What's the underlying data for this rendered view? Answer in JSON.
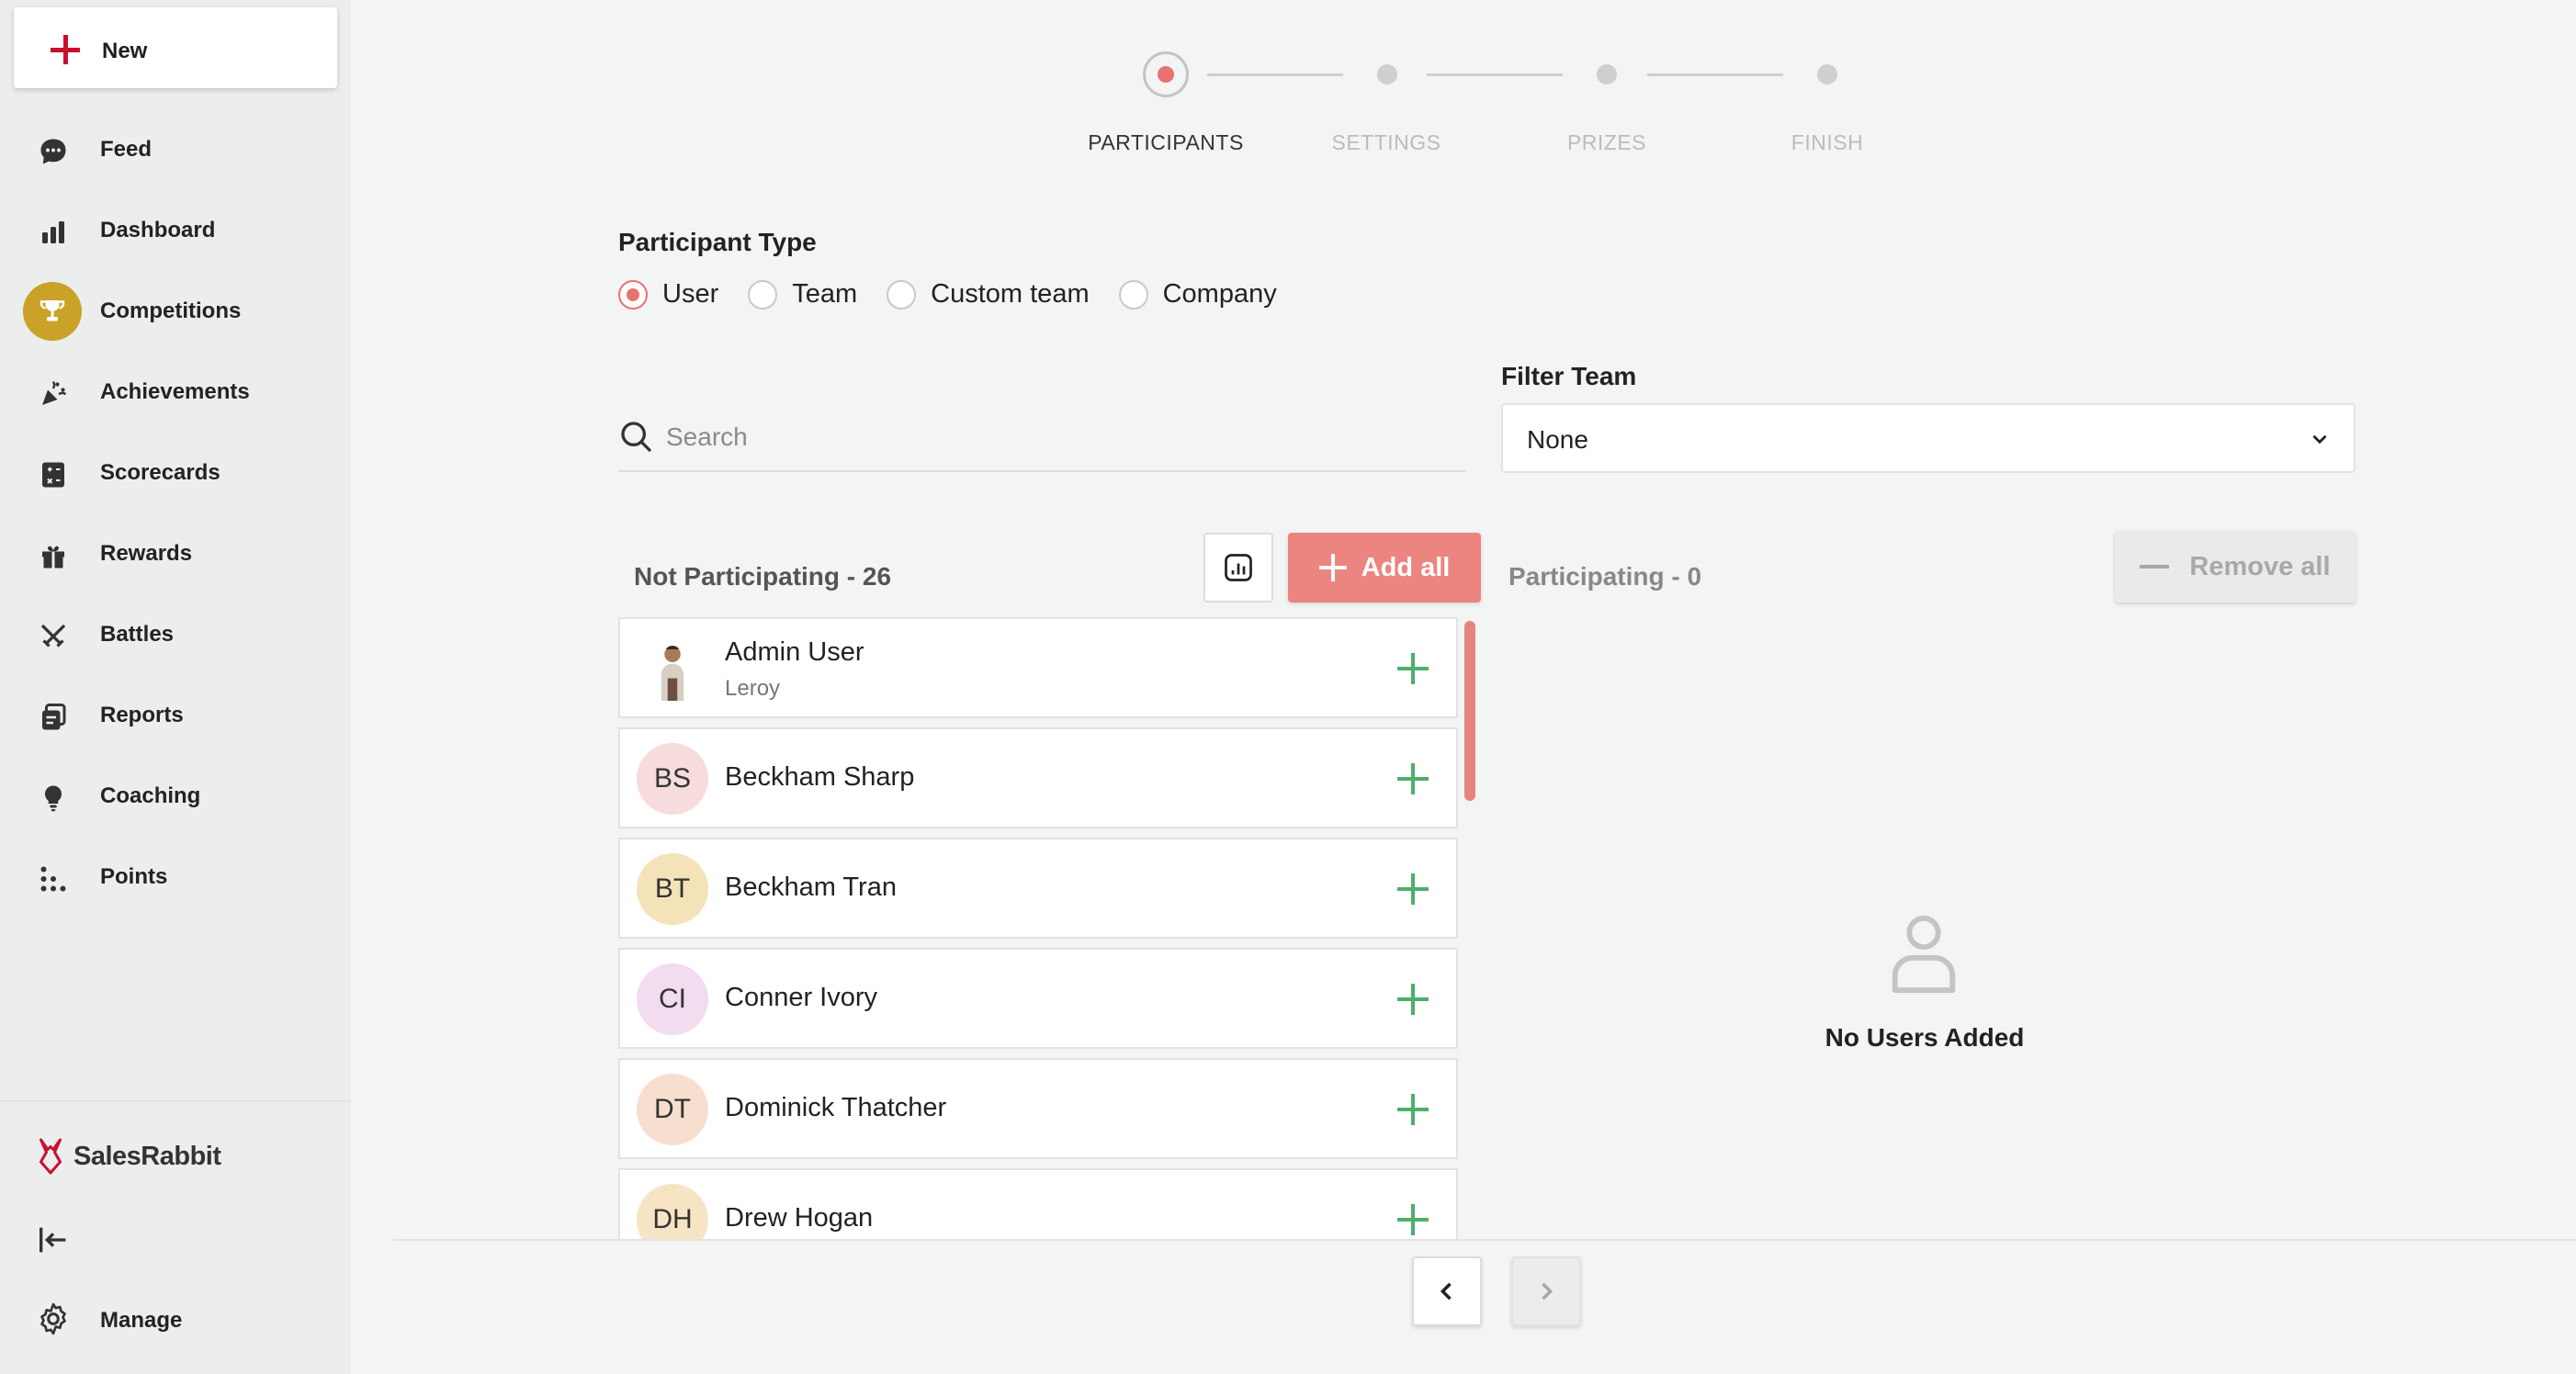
{
  "sidebar": {
    "new_label": "New",
    "items": [
      {
        "label": "Feed",
        "icon": "chat-bubble-icon"
      },
      {
        "label": "Dashboard",
        "icon": "bar-chart-icon"
      },
      {
        "label": "Competitions",
        "icon": "trophy-icon",
        "active": true
      },
      {
        "label": "Achievements",
        "icon": "party-popper-icon"
      },
      {
        "label": "Scorecards",
        "icon": "scorecard-icon"
      },
      {
        "label": "Rewards",
        "icon": "gift-icon"
      },
      {
        "label": "Battles",
        "icon": "crossed-swords-icon"
      },
      {
        "label": "Reports",
        "icon": "reports-icon"
      },
      {
        "label": "Coaching",
        "icon": "lightbulb-icon"
      },
      {
        "label": "Points",
        "icon": "dots-icon"
      }
    ],
    "brand": "SalesRabbit",
    "manage_label": "Manage"
  },
  "stepper": {
    "steps": [
      "PARTICIPANTS",
      "SETTINGS",
      "PRIZES",
      "FINISH"
    ],
    "active_index": 0
  },
  "participant_type": {
    "title": "Participant Type",
    "options": [
      "User",
      "Team",
      "Custom team",
      "Company"
    ],
    "selected": "User"
  },
  "search": {
    "placeholder": "Search",
    "value": ""
  },
  "filter": {
    "title": "Filter Team",
    "value": "None"
  },
  "not_participating": {
    "title": "Not Participating - 26",
    "add_all_label": "Add all",
    "users": [
      {
        "name": "Admin User",
        "subtitle": "Leroy",
        "initials": "",
        "avatar_color": "#ffffff",
        "photo": true
      },
      {
        "name": "Beckham Sharp",
        "initials": "BS",
        "avatar_color": "#f6dcdc"
      },
      {
        "name": "Beckham Tran",
        "initials": "BT",
        "avatar_color": "#f4e3b8"
      },
      {
        "name": "Conner Ivory",
        "initials": "CI",
        "avatar_color": "#f1dcf0"
      },
      {
        "name": "Dominick Thatcher",
        "initials": "DT",
        "avatar_color": "#f8dece"
      },
      {
        "name": "Drew Hogan",
        "initials": "DH",
        "avatar_color": "#f7e4c4"
      }
    ]
  },
  "participating": {
    "title": "Participating - 0",
    "remove_all_label": "Remove all",
    "empty_text": "No Users Added"
  },
  "colors": {
    "accent": "#ec8480",
    "active_nav": "#c9a227",
    "add_green": "#4caf6a"
  }
}
